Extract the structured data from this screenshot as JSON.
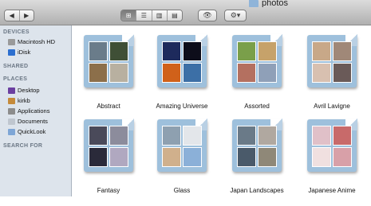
{
  "window": {
    "title": "photos"
  },
  "toolbar": {
    "back_icon": "chevron-left-icon",
    "forward_icon": "chevron-right-icon",
    "view_icons": [
      "icon-view-icon",
      "list-view-icon",
      "column-view-icon",
      "coverflow-view-icon"
    ],
    "quicklook_icon": "eye-icon",
    "action_icon": "gear-icon"
  },
  "sidebar": {
    "sections": {
      "devices": "DEVICES",
      "shared": "SHARED",
      "places": "PLACES",
      "search": "SEARCH FOR"
    },
    "devices": [
      "Macintosh HD",
      "iDisk"
    ],
    "places": [
      "Desktop",
      "kirkb",
      "Applications",
      "Documents",
      "QuickLook"
    ]
  },
  "folders": [
    {
      "name": "Abstract",
      "thumbs": [
        "#6a7c8a",
        "#3f4f36",
        "#8c6f4a",
        "#b8b0a0"
      ]
    },
    {
      "name": "Amazing Universe",
      "thumbs": [
        "#1d2a5c",
        "#0d0d1a",
        "#d0611a",
        "#3c6fa6"
      ]
    },
    {
      "name": "Assorted",
      "thumbs": [
        "#7a9f4a",
        "#c6a26a",
        "#b47060",
        "#8fa0b8"
      ]
    },
    {
      "name": "Avril Lavigne",
      "thumbs": [
        "#c8a888",
        "#a08878",
        "#d8c0b0",
        "#6a5a58"
      ]
    },
    {
      "name": "Fantasy",
      "thumbs": [
        "#4a4a5a",
        "#8c8c9c",
        "#2a2a3a",
        "#b0a8c0"
      ]
    },
    {
      "name": "Glass",
      "thumbs": [
        "#8ea0b0",
        "#e3e6ea",
        "#d0b08c",
        "#8bb0d8"
      ]
    },
    {
      "name": "Japan Landscapes",
      "thumbs": [
        "#6a7a88",
        "#b0a8a0",
        "#4a5a6a",
        "#8f8878"
      ]
    },
    {
      "name": "Japanese Anime",
      "thumbs": [
        "#e0c0c8",
        "#c86a6a",
        "#f0e0e0",
        "#d8a0a8"
      ]
    }
  ]
}
